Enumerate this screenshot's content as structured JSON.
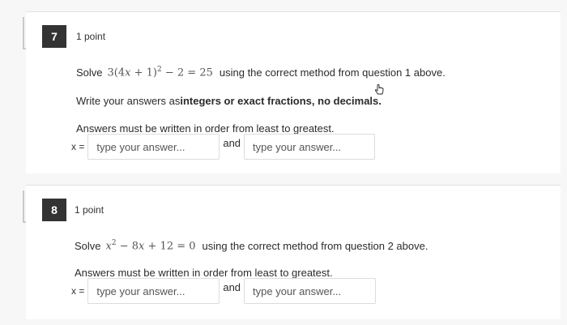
{
  "questions": [
    {
      "number": "7",
      "points": "1 point",
      "prompt_prefix": "Solve",
      "prompt_suffix": "using the correct method from question 1 above.",
      "instruction_prefix": "Write your answers as ",
      "instruction_bold": "integers or exact fractions, no decimals.",
      "order_note": "Answers must be written in order from least to greatest.",
      "x_label": "x =",
      "and_label": "and",
      "placeholder_1": "type your answer...",
      "placeholder_2": "type your answer..."
    },
    {
      "number": "8",
      "points": "1 point",
      "prompt_prefix": "Solve",
      "prompt_suffix": "using the correct method from question 2 above.",
      "order_note": "Answers must be written in order from least to greatest.",
      "x_label": "x =",
      "and_label": "and",
      "placeholder_1": "type your answer...",
      "placeholder_2": "type your answer..."
    }
  ],
  "icons": {
    "cursor": "hand-pointer-icon"
  }
}
